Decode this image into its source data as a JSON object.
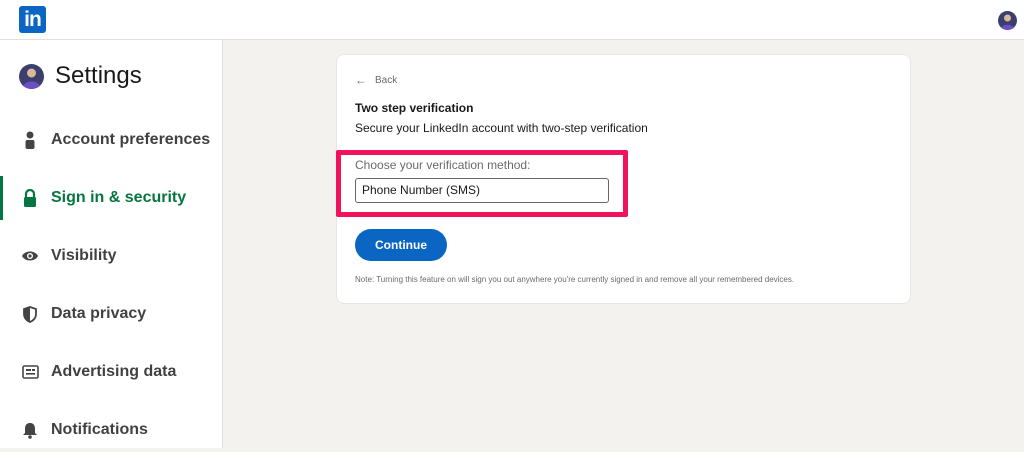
{
  "header": {
    "logo_text": "in"
  },
  "sidebar": {
    "title": "Settings",
    "items": [
      {
        "label": "Account preferences",
        "icon": "person-icon"
      },
      {
        "label": "Sign in & security",
        "icon": "lock-icon",
        "active": true
      },
      {
        "label": "Visibility",
        "icon": "eye-icon"
      },
      {
        "label": "Data privacy",
        "icon": "shield-icon"
      },
      {
        "label": "Advertising data",
        "icon": "ad-icon"
      },
      {
        "label": "Notifications",
        "icon": "bell-icon"
      }
    ]
  },
  "main": {
    "back_label": "Back",
    "title": "Two step verification",
    "subtitle": "Secure your LinkedIn account with two-step verification",
    "method_label": "Choose your verification method:",
    "method_value": "Phone Number (SMS)",
    "continue_label": "Continue",
    "note": "Note: Turning this feature on will sign you out anywhere you're currently signed in and remove all your remembered devices."
  },
  "colors": {
    "brand": "#0a66c2",
    "active": "#057642",
    "highlight": "#f0125a"
  }
}
